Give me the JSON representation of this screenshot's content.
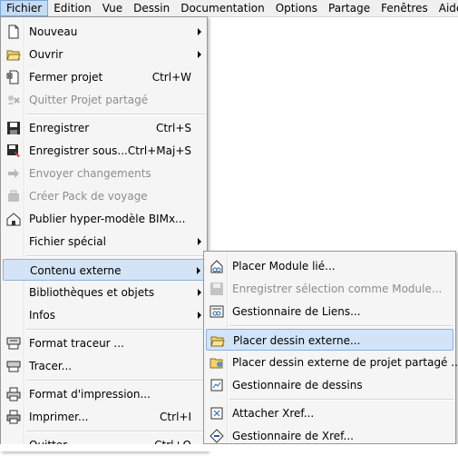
{
  "menubar": [
    {
      "label": "Fichier",
      "active": true
    },
    {
      "label": "Edition"
    },
    {
      "label": "Vue"
    },
    {
      "label": "Dessin"
    },
    {
      "label": "Documentation"
    },
    {
      "label": "Options"
    },
    {
      "label": "Partage"
    },
    {
      "label": "Fenêtres"
    },
    {
      "label": "Aide"
    }
  ],
  "file_menu": [
    {
      "label": "Nouveau",
      "submenu": true,
      "icon": "new-doc-icon"
    },
    {
      "label": "Ouvrir",
      "submenu": true,
      "icon": "open-folder-icon"
    },
    {
      "label": "Fermer projet",
      "shortcut": "Ctrl+W",
      "icon": "close-project-icon"
    },
    {
      "label": "Quitter Projet partagé",
      "disabled": true,
      "icon": "leave-shared-icon"
    },
    {
      "separator": true
    },
    {
      "label": "Enregistrer",
      "shortcut": "Ctrl+S",
      "icon": "save-icon"
    },
    {
      "label": "Enregistrer sous...",
      "shortcut": "Ctrl+Maj+S",
      "icon": "save-as-icon"
    },
    {
      "label": "Envoyer changements",
      "disabled": true,
      "icon": "send-changes-icon"
    },
    {
      "label": "Créer Pack de voyage",
      "disabled": true,
      "icon": "travel-pack-icon"
    },
    {
      "label": "Publier hyper-modèle BIMx...",
      "icon": "bimx-icon"
    },
    {
      "label": "Fichier spécial",
      "submenu": true
    },
    {
      "separator": true
    },
    {
      "label": "Contenu externe",
      "submenu": true,
      "highlight": true
    },
    {
      "label": "Bibliothèques et objets",
      "submenu": true
    },
    {
      "label": "Infos",
      "submenu": true
    },
    {
      "separator": true
    },
    {
      "label": "Format traceur ...",
      "icon": "plotter-setup-icon"
    },
    {
      "label": "Tracer...",
      "icon": "plotter-icon"
    },
    {
      "separator": true
    },
    {
      "label": "Format d'impression...",
      "icon": "print-setup-icon"
    },
    {
      "label": "Imprimer...",
      "shortcut": "Ctrl+I",
      "icon": "printer-icon"
    },
    {
      "separator": true
    },
    {
      "label": "Quitter",
      "shortcut": "Ctrl+Q"
    }
  ],
  "submenu": [
    {
      "label": "Placer Module lié...",
      "icon": "hotlink-module-icon"
    },
    {
      "label": "Enregistrer sélection comme Module...",
      "disabled": true,
      "icon": "save-module-icon"
    },
    {
      "label": "Gestionnaire de Liens...",
      "icon": "link-manager-icon"
    },
    {
      "separator": true
    },
    {
      "label": "Placer dessin externe...",
      "highlight": true,
      "icon": "place-drawing-icon"
    },
    {
      "label": "Placer dessin externe de projet partagé ...",
      "icon": "shared-drawing-icon"
    },
    {
      "label": "Gestionnaire de dessins",
      "icon": "drawing-manager-icon"
    },
    {
      "separator": true
    },
    {
      "label": "Attacher Xref...",
      "icon": "xref-attach-icon"
    },
    {
      "label": "Gestionnaire de Xref...",
      "icon": "xref-manager-icon"
    }
  ],
  "colors": {
    "highlight": "#d3e4f6",
    "highlight_border": "#8bb2dd",
    "disabled_text": "#8d8d8d",
    "menu_bg": "#f5f5f5"
  }
}
